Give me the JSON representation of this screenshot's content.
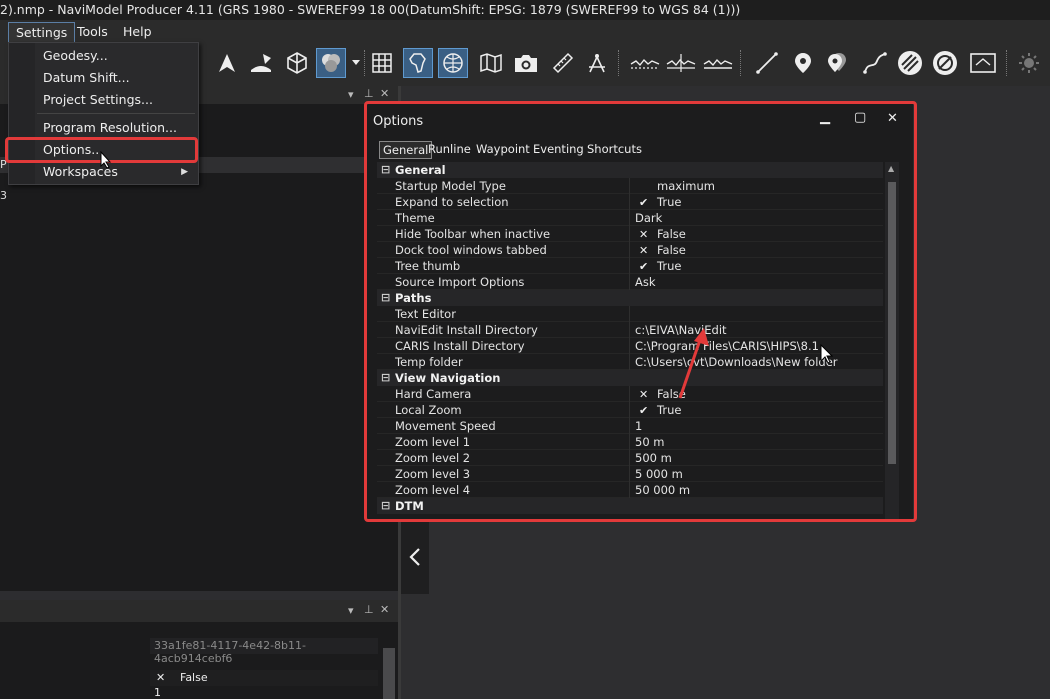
{
  "window": {
    "title": "2).nmp - NaviModel Producer 4.11 (GRS 1980 - SWEREF99 18 00(DatumShift: EPSG: 1879 (SWEREF99 to WGS 84 (1)))"
  },
  "menu": {
    "items": [
      "Settings",
      "Tools",
      "Help"
    ]
  },
  "settings_menu": {
    "items": [
      "Geodesy...",
      "Datum Shift...",
      "Project Settings...",
      "Program Resolution...",
      "Options...",
      "Workspaces"
    ]
  },
  "left_panel": {
    "fragment_text": "3",
    "row_marker": "P"
  },
  "lower_panel": {
    "guid": "33a1fe81-4117-4e42-8b11-4acb914cebf6",
    "value_false": "False",
    "value_one": "1",
    "x_mark": "✕"
  },
  "options": {
    "title": "Options",
    "tabs": [
      "General",
      "Runline",
      "Waypoint",
      "Eventing",
      "Shortcuts"
    ],
    "selected_tab": "General",
    "categories": {
      "general": "General",
      "paths": "Paths",
      "view_navigation": "View Navigation",
      "dtm": "DTM"
    },
    "rows": [
      {
        "name": "Startup Model Type",
        "value": "maximum",
        "icon": ""
      },
      {
        "name": "Expand to selection",
        "value": "True",
        "icon": "✔"
      },
      {
        "name": "Theme",
        "value": "Dark",
        "icon": ""
      },
      {
        "name": "Hide Toolbar when inactive",
        "value": "False",
        "icon": "✕"
      },
      {
        "name": "Dock tool windows tabbed",
        "value": "False",
        "icon": "✕"
      },
      {
        "name": "Tree thumb",
        "value": "True",
        "icon": "✔"
      },
      {
        "name": "Source Import Options",
        "value": "Ask",
        "icon": ""
      },
      {
        "name": "Text Editor",
        "value": "",
        "icon": ""
      },
      {
        "name": "NaviEdit Install Directory",
        "value": "c:\\EIVA\\NaviEdit",
        "icon": ""
      },
      {
        "name": "CARIS Install Directory",
        "value": "C:\\Program Files\\CARIS\\HIPS\\8.1",
        "icon": ""
      },
      {
        "name": "Temp folder",
        "value": "C:\\Users\\cvt\\Downloads\\New folder",
        "icon": ""
      },
      {
        "name": "Hard Camera",
        "value": "False",
        "icon": "✕"
      },
      {
        "name": "Local Zoom",
        "value": "True",
        "icon": "✔"
      },
      {
        "name": "Movement Speed",
        "value": "1",
        "icon": ""
      },
      {
        "name": "Zoom level 1",
        "value": "50 m",
        "icon": ""
      },
      {
        "name": "Zoom level 2",
        "value": "500 m",
        "icon": ""
      },
      {
        "name": "Zoom level 3",
        "value": "5 000 m",
        "icon": ""
      },
      {
        "name": "Zoom level 4",
        "value": "50 000 m",
        "icon": ""
      }
    ],
    "toggle": "⊟"
  },
  "colors": {
    "highlight": "#e23a3a",
    "selected_tool": "#3a5f84",
    "arrow": "#e23a3a"
  }
}
